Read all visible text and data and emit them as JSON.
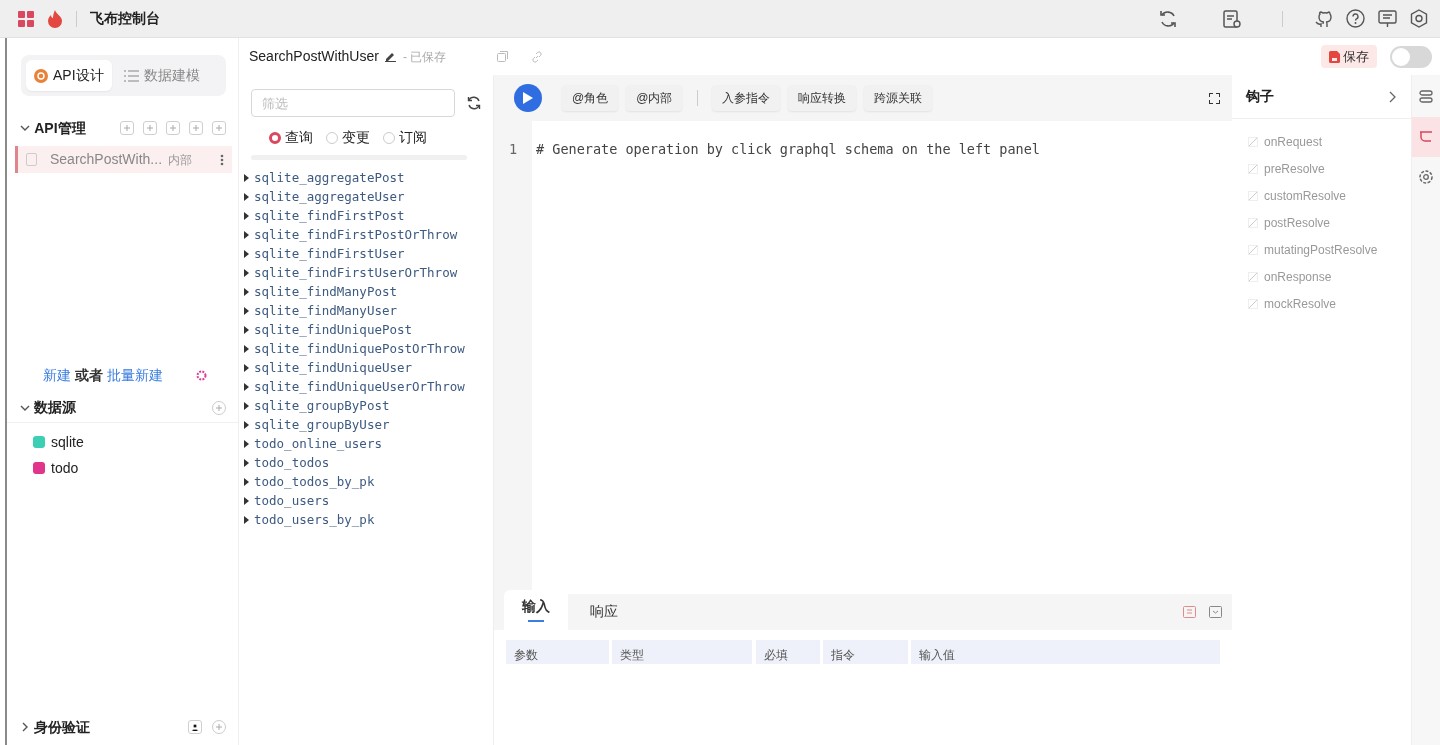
{
  "app_bar": {
    "title": "飞布控制台"
  },
  "sidebar": {
    "mode_tabs": [
      {
        "label": "API设计",
        "selected": true
      },
      {
        "label": "数据建模",
        "selected": false
      }
    ],
    "api_section": {
      "title": "API管理",
      "expanded": true,
      "items": [
        {
          "name": "SearchPostWith...",
          "tag": "内部",
          "selected": true
        }
      ]
    },
    "create_hint": {
      "new": "新建",
      "or": "或者",
      "batch": "批量新建"
    },
    "datasource_section": {
      "title": "数据源",
      "expanded": true,
      "items": [
        {
          "name": "sqlite",
          "color": "#3ccfb4"
        },
        {
          "name": "todo",
          "color": "#e0358a"
        }
      ]
    },
    "auth_section": {
      "title": "身份验证",
      "expanded": false
    }
  },
  "operation": {
    "name": "SearchPostWithUser",
    "status": "- 已保存",
    "save_button": "保存",
    "toggle": {
      "on": false
    }
  },
  "explorer": {
    "filter": {
      "placeholder": "筛选"
    },
    "op_types": [
      {
        "label": "查询",
        "selected": true
      },
      {
        "label": "变更",
        "selected": false
      },
      {
        "label": "订阅",
        "selected": false
      }
    ],
    "fields": [
      "sqlite_aggregatePost",
      "sqlite_aggregateUser",
      "sqlite_findFirstPost",
      "sqlite_findFirstPostOrThrow",
      "sqlite_findFirstUser",
      "sqlite_findFirstUserOrThrow",
      "sqlite_findManyPost",
      "sqlite_findManyUser",
      "sqlite_findUniquePost",
      "sqlite_findUniquePostOrThrow",
      "sqlite_findUniqueUser",
      "sqlite_findUniqueUserOrThrow",
      "sqlite_groupByPost",
      "sqlite_groupByUser",
      "todo_online_users",
      "todo_todos",
      "todo_todos_by_pk",
      "todo_users",
      "todo_users_by_pk"
    ]
  },
  "editor": {
    "toolbar_groups": [
      [
        "@角色",
        "@内部"
      ],
      [
        "入参指令",
        "响应转换",
        "跨源关联"
      ]
    ],
    "lines": [
      {
        "number": "1",
        "text": "# Generate operation by click graphql schema on the left panel"
      }
    ],
    "bottom_tabs": [
      {
        "label": "输入",
        "selected": true
      },
      {
        "label": "响应",
        "selected": false
      }
    ],
    "table": {
      "columns": [
        "参数",
        "类型",
        "必填",
        "指令",
        "输入值"
      ]
    }
  },
  "hooks": {
    "title": "钩子",
    "items": [
      "onRequest",
      "preResolve",
      "customResolve",
      "postResolve",
      "mutatingPostResolve",
      "onResponse",
      "mockResolve"
    ]
  },
  "rail": [
    {
      "kind": "layers",
      "selected": false
    },
    {
      "kind": "hook",
      "selected": true
    },
    {
      "kind": "settings",
      "selected": false
    }
  ]
}
